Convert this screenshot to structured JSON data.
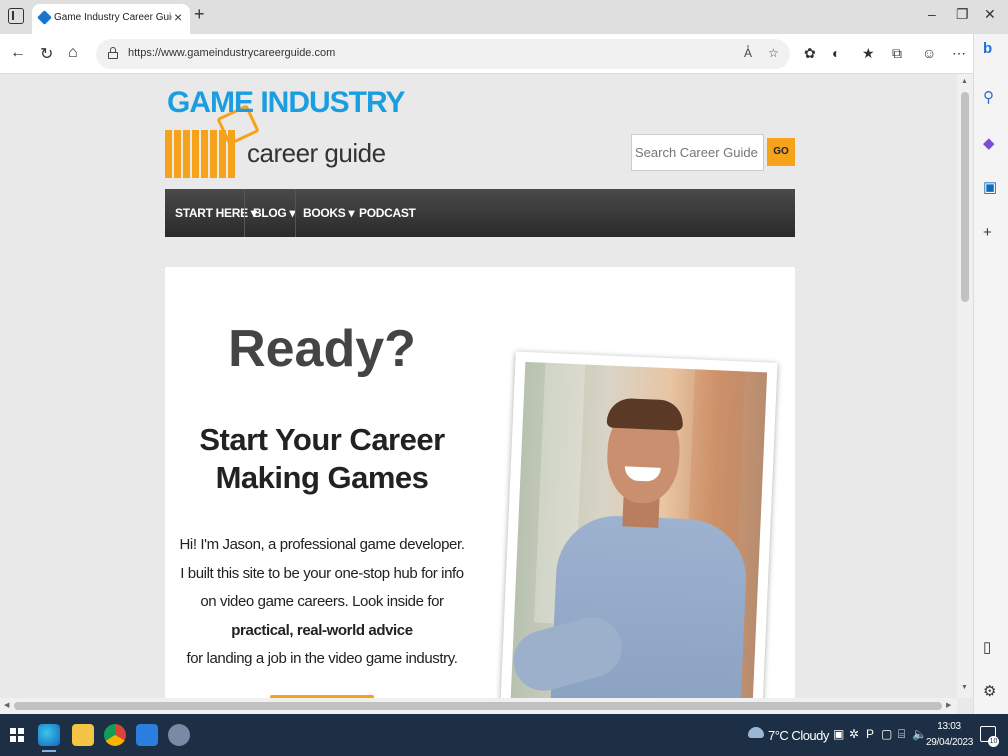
{
  "browser": {
    "tab_title": "Game Industry Career Guide - Yo",
    "url": "https://www.gameindustrycareerguide.com",
    "new_tab": "+",
    "close": "×",
    "window": {
      "minimize": "–",
      "restore": "❐",
      "close": "✕"
    },
    "read_aloud": "A̓"
  },
  "site": {
    "logo_line1": "GAME INDUSTRY",
    "logo_line2": "career guide",
    "search_placeholder": "Search Career Guide",
    "search_button": "GO",
    "nav": [
      {
        "label": "START HERE ▾"
      },
      {
        "label": "BLOG ▾"
      },
      {
        "label": "BOOKS ▾"
      },
      {
        "label": "PODCAST"
      }
    ],
    "hero": {
      "heading": "Ready?",
      "subheading_line1": "Start Your Career",
      "subheading_line2": "Making Games",
      "para_1": "Hi! I'm Jason, a professional game developer. I built this site to be your one-stop hub for info on video game careers. Look inside for",
      "para_bold": "practical, real-world advice",
      "para_2": "for landing a job in the video game industry."
    }
  },
  "taskbar": {
    "weather": "7°C Cloudy",
    "time": "13:03",
    "date": "29/04/2023",
    "notification_count": "10"
  },
  "colors": {
    "brand_blue": "#1b9ee0",
    "brand_orange": "#f7a21b",
    "nav_dark": "#333333",
    "taskbar": "#1c2f44"
  }
}
